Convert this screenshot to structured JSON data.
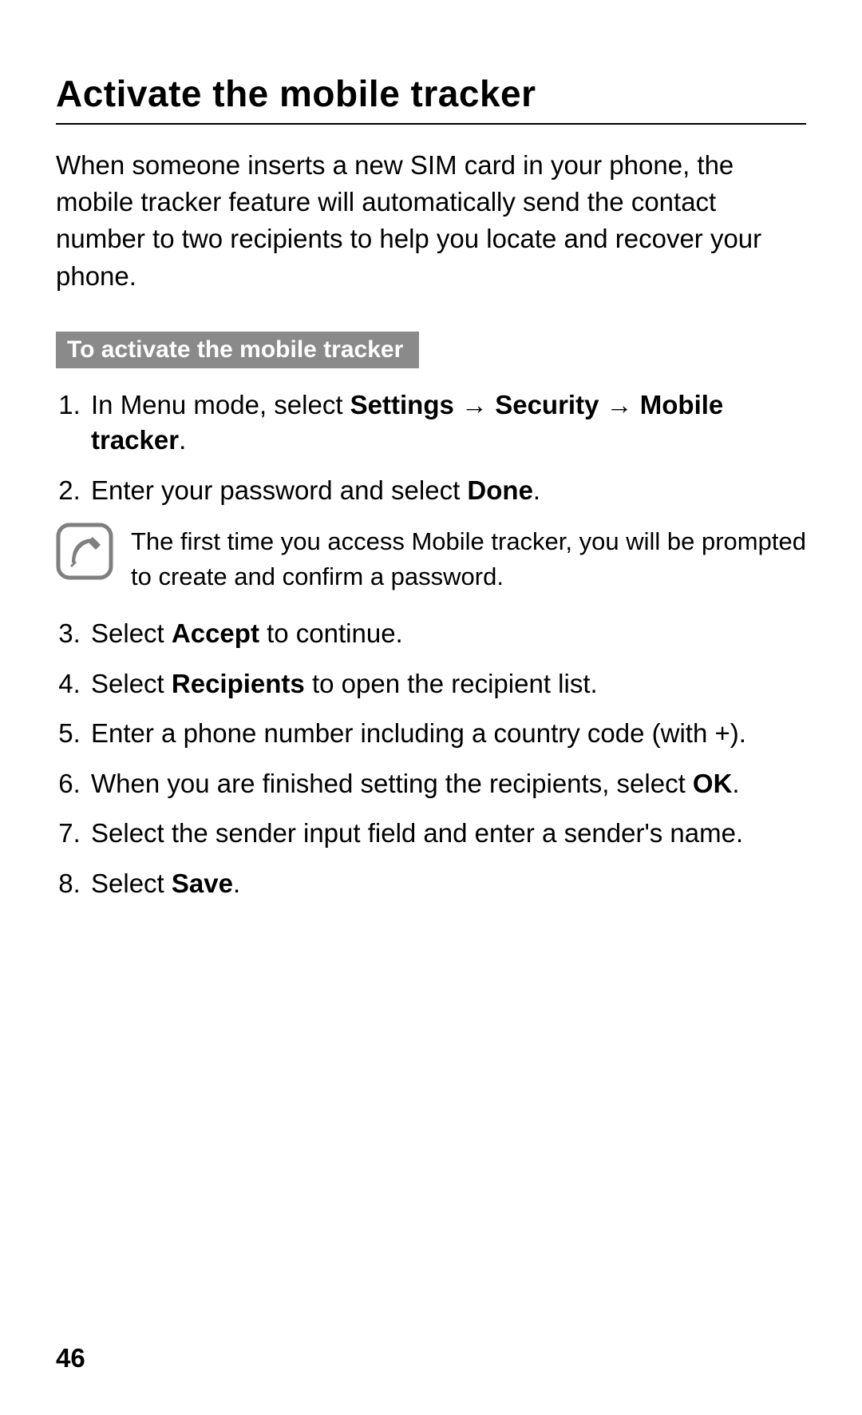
{
  "title": "Activate the mobile tracker",
  "intro": "When someone inserts a new SIM card in your phone, the mobile tracker feature will automatically send the contact number to two recipients to help you locate and recover your phone.",
  "section_label": "To activate the mobile tracker",
  "steps": {
    "s1_prefix": "In Menu mode, select ",
    "s1_b1": "Settings",
    "s1_arrow": " → ",
    "s1_b2": "Security",
    "s1_b3": "Mobile tracker",
    "s1_suffix": ".",
    "s2_prefix": "Enter your password and select ",
    "s2_b1": "Done",
    "s2_suffix": ".",
    "note": "The first time you access Mobile tracker, you will be prompted to create and confirm a password.",
    "s3_prefix": "Select ",
    "s3_b1": "Accept",
    "s3_suffix": " to continue.",
    "s4_prefix": "Select ",
    "s4_b1": "Recipients",
    "s4_suffix": " to open the recipient list.",
    "s5": "Enter a phone number including a country code (with +).",
    "s6_prefix": "When you are finished setting the recipients, select ",
    "s6_b1": "OK",
    "s6_suffix": ".",
    "s7": "Select the sender input field and enter a sender's name.",
    "s8_prefix": "Select ",
    "s8_b1": "Save",
    "s8_suffix": "."
  },
  "page_number": "46"
}
